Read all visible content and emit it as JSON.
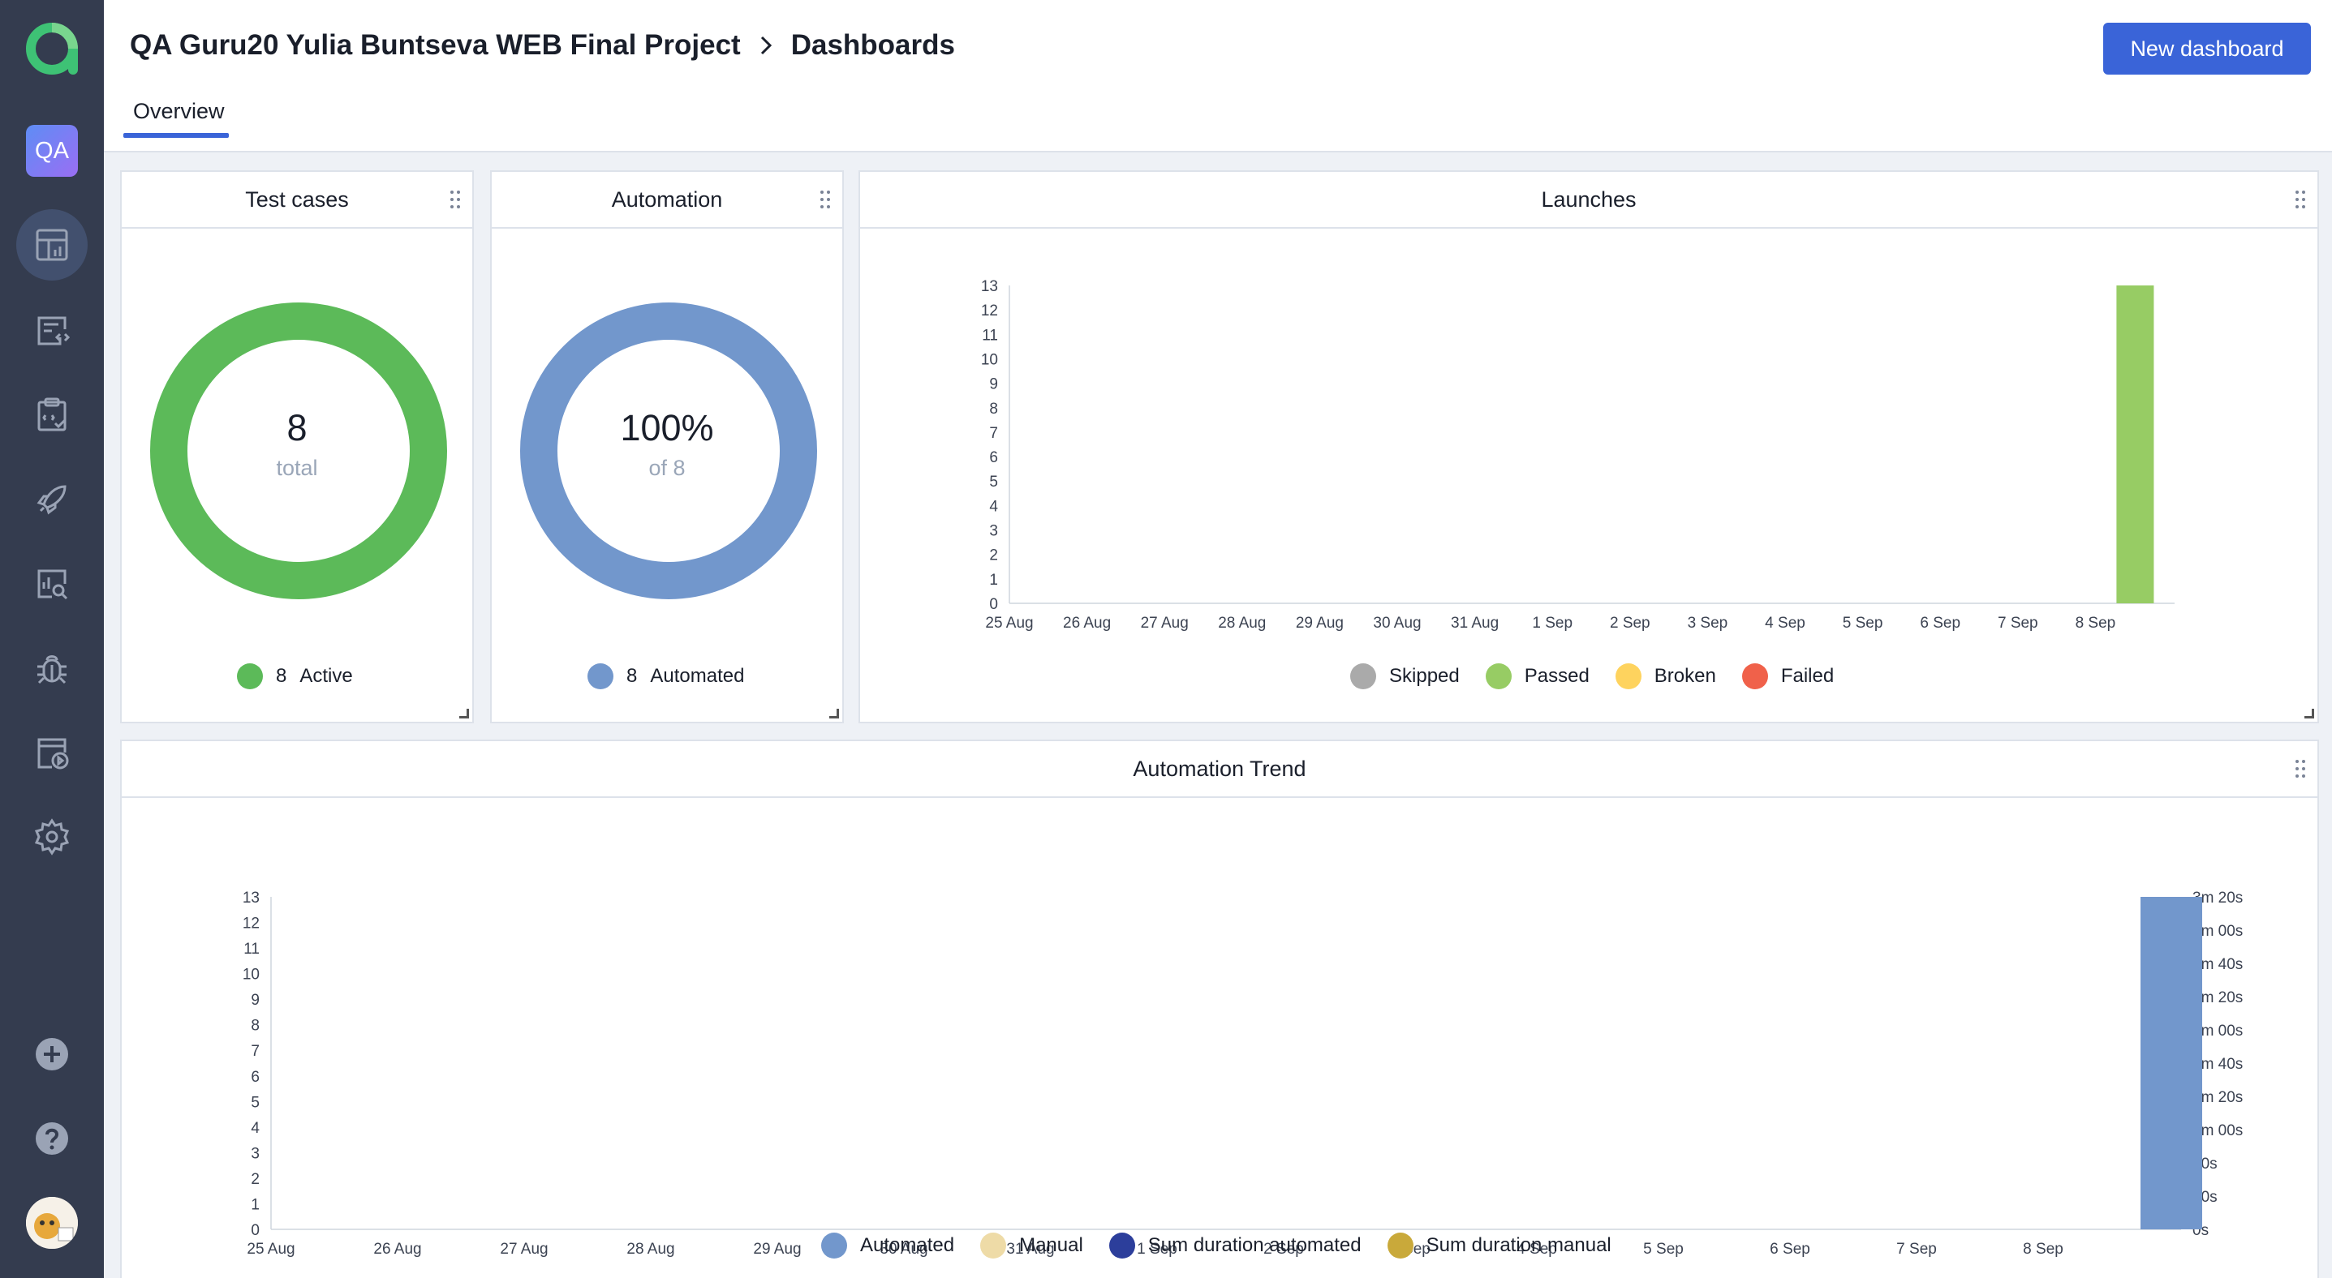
{
  "header": {
    "project": "QA Guru20 Yulia Buntseva WEB Final Project",
    "page": "Dashboards",
    "new_button": "New dashboard"
  },
  "sidebar": {
    "project_badge": "QA",
    "items": [
      {
        "name": "dashboards-icon",
        "active": true
      },
      {
        "name": "test-cases-icon"
      },
      {
        "name": "test-plans-icon"
      },
      {
        "name": "launches-icon"
      },
      {
        "name": "analytics-icon"
      },
      {
        "name": "defects-icon"
      },
      {
        "name": "jobs-icon"
      },
      {
        "name": "settings-icon"
      }
    ],
    "bottom": [
      {
        "name": "add-icon"
      },
      {
        "name": "help-icon"
      },
      {
        "name": "avatar"
      }
    ]
  },
  "tabs": [
    {
      "label": "Overview",
      "active": true
    }
  ],
  "widgets": {
    "test_cases": {
      "title": "Test cases",
      "total": "8",
      "total_label": "total",
      "legend": [
        {
          "count": "8",
          "label": "Active",
          "color": "#5cba59"
        }
      ]
    },
    "automation": {
      "title": "Automation",
      "percent": "100%",
      "of_label": "of 8",
      "legend": [
        {
          "count": "8",
          "label": "Automated",
          "color": "#7297cc"
        }
      ]
    },
    "launches": {
      "title": "Launches",
      "legend": [
        {
          "label": "Skipped",
          "color": "#aaaaaa"
        },
        {
          "label": "Passed",
          "color": "#97cc64"
        },
        {
          "label": "Broken",
          "color": "#fed35e"
        },
        {
          "label": "Failed",
          "color": "#f0614a"
        }
      ]
    },
    "automation_trend": {
      "title": "Automation Trend",
      "legend": [
        {
          "label": "Automated",
          "color": "#7297cc"
        },
        {
          "label": "Manual",
          "color": "#eedba7"
        },
        {
          "label": "Sum duration automated",
          "color": "#2c3e9b"
        },
        {
          "label": "Sum duration manual",
          "color": "#c9a93a"
        }
      ]
    }
  },
  "chart_data": [
    {
      "type": "bar",
      "title": "Launches",
      "categories": [
        "25 Aug",
        "26 Aug",
        "27 Aug",
        "28 Aug",
        "29 Aug",
        "30 Aug",
        "31 Aug",
        "1 Sep",
        "2 Sep",
        "3 Sep",
        "4 Sep",
        "5 Sep",
        "6 Sep",
        "7 Sep",
        "8 Sep"
      ],
      "series": [
        {
          "name": "Skipped",
          "color": "#aaaaaa",
          "values": [
            0,
            0,
            0,
            0,
            0,
            0,
            0,
            0,
            0,
            0,
            0,
            0,
            0,
            0,
            0
          ]
        },
        {
          "name": "Passed",
          "color": "#97cc64",
          "values": [
            0,
            0,
            0,
            0,
            0,
            0,
            0,
            0,
            0,
            0,
            0,
            0,
            0,
            0,
            13
          ]
        },
        {
          "name": "Broken",
          "color": "#fed35e",
          "values": [
            0,
            0,
            0,
            0,
            0,
            0,
            0,
            0,
            0,
            0,
            0,
            0,
            0,
            0,
            0
          ]
        },
        {
          "name": "Failed",
          "color": "#f0614a",
          "values": [
            0,
            0,
            0,
            0,
            0,
            0,
            0,
            0,
            0,
            0,
            0,
            0,
            0,
            0,
            0
          ]
        }
      ],
      "ylim": [
        0,
        13
      ],
      "yticks": [
        "0",
        "1",
        "2",
        "3",
        "4",
        "5",
        "6",
        "7",
        "8",
        "9",
        "10",
        "11",
        "12",
        "13"
      ],
      "stacked": true,
      "legend": "bottom"
    },
    {
      "type": "bar",
      "title": "Automation Trend",
      "categories": [
        "25 Aug",
        "26 Aug",
        "27 Aug",
        "28 Aug",
        "29 Aug",
        "30 Aug",
        "31 Aug",
        "1 Sep",
        "2 Sep",
        "3 Sep",
        "4 Sep",
        "5 Sep",
        "6 Sep",
        "7 Sep",
        "8 Sep"
      ],
      "series": [
        {
          "name": "Automated",
          "color": "#7297cc",
          "values": [
            0,
            0,
            0,
            0,
            0,
            0,
            0,
            0,
            0,
            0,
            0,
            0,
            0,
            0,
            13
          ]
        },
        {
          "name": "Manual",
          "color": "#eedba7",
          "values": [
            0,
            0,
            0,
            0,
            0,
            0,
            0,
            0,
            0,
            0,
            0,
            0,
            0,
            0,
            0
          ]
        }
      ],
      "ylim": [
        0,
        13
      ],
      "yticks": [
        "0",
        "1",
        "2",
        "3",
        "4",
        "5",
        "6",
        "7",
        "8",
        "9",
        "10",
        "11",
        "12",
        "13"
      ],
      "y2ticks": [
        "0s",
        "20s",
        "40s",
        "1m 00s",
        "1m 20s",
        "1m 40s",
        "2m 00s",
        "2m 20s",
        "2m 40s",
        "3m 00s",
        "3m 20s"
      ],
      "legend": "bottom"
    }
  ]
}
